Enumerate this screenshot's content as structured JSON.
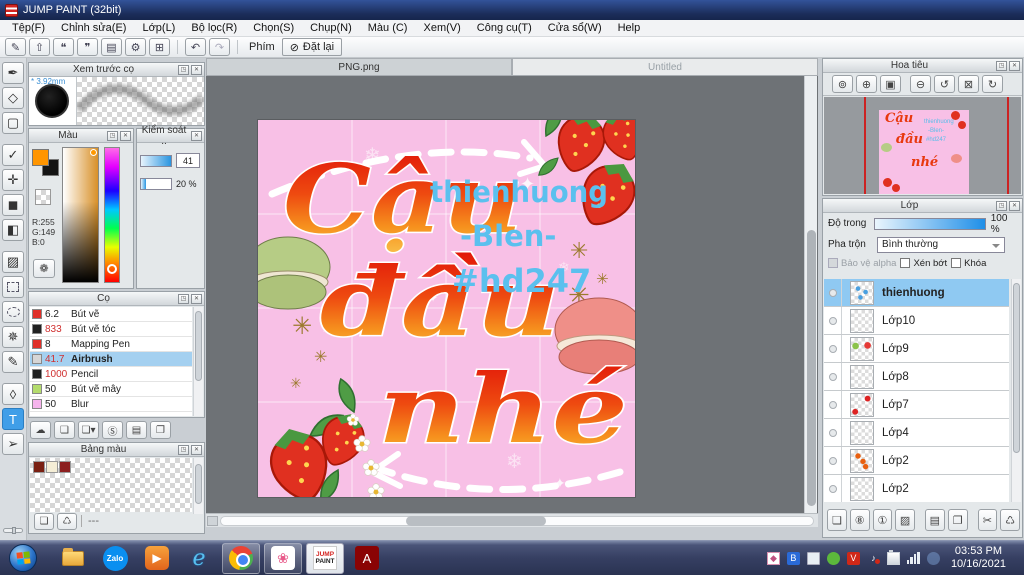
{
  "window": {
    "title": "JUMP PAINT (32bit)"
  },
  "menu": {
    "items": [
      {
        "label": "Tệp(F)"
      },
      {
        "label": "Chỉnh sửa(E)"
      },
      {
        "label": "Lớp(L)"
      },
      {
        "label": "Bộ lọc(R)"
      },
      {
        "label": "Chọn(S)"
      },
      {
        "label": "Chụp(N)"
      },
      {
        "label": "Màu (C)"
      },
      {
        "label": "Xem(V)"
      },
      {
        "label": "Công cụ(T)"
      },
      {
        "label": "Cửa sổ(W)"
      },
      {
        "label": "Help"
      }
    ]
  },
  "toolbar": {
    "main_buttons": [
      {
        "name": "jump-pen-icon",
        "glyph": "✎"
      },
      {
        "name": "upload-icon",
        "glyph": "⇧"
      },
      {
        "name": "comment-icon",
        "glyph": "❝"
      },
      {
        "name": "speech-icon",
        "glyph": "❞"
      },
      {
        "name": "document-icon",
        "glyph": "▤"
      },
      {
        "name": "panel-settings-icon",
        "glyph": "⚙"
      },
      {
        "name": "grid-edit-icon",
        "glyph": "⊞"
      }
    ],
    "undo_glyph": "↶",
    "redo_glyph": "↷",
    "keys_label": "Phím",
    "reset": {
      "glyph": "⊘",
      "label": "Đặt lại"
    }
  },
  "tools": {
    "items": [
      {
        "name": "brush-tool-icon",
        "glyph": "✒"
      },
      {
        "name": "eraser-tool-icon",
        "glyph": "◇"
      },
      {
        "name": "shape-tool-icon",
        "glyph": "▢"
      },
      {
        "name": "dot-pen-tool-icon",
        "glyph": "✓"
      },
      {
        "name": "move-tool-icon",
        "glyph": "✛"
      },
      {
        "name": "fill-shape-tool-icon",
        "glyph": "◼"
      },
      {
        "name": "bucket-tool-icon",
        "glyph": "◧"
      },
      {
        "name": "gradient-tool-icon",
        "glyph": "▨"
      },
      {
        "name": "select-rect-tool-icon",
        "glyph": "",
        "shape": "dashed-rect"
      },
      {
        "name": "lasso-tool-icon",
        "glyph": "",
        "shape": "dashed-ellipse"
      },
      {
        "name": "magic-wand-tool-icon",
        "glyph": "✵"
      },
      {
        "name": "select-pen-tool-icon",
        "glyph": "✎"
      },
      {
        "name": "select-eraser-tool-icon",
        "glyph": "◊"
      },
      {
        "name": "text-tool-icon",
        "glyph": "T",
        "selected": true
      },
      {
        "name": "object-tool-icon",
        "glyph": "➢"
      }
    ]
  },
  "brush_preview": {
    "title": "Xem trước cọ",
    "size_label": "* 3.92mm"
  },
  "color_panel": {
    "title": "Màu",
    "r": "R:255",
    "g": "G:149",
    "b": "B:0",
    "palette_glyph": "❁"
  },
  "control_panel": {
    "title": "Kiểm soát ..",
    "value1": "41",
    "value2": "20 %"
  },
  "brush_panel": {
    "title": "Cọ",
    "items": [
      {
        "size": "6.2",
        "name": "Bút vẽ",
        "swatch": "#e03028",
        "size_red": false
      },
      {
        "size": "833",
        "name": "Bút vẽ tóc",
        "swatch": "#202020",
        "size_red": true
      },
      {
        "size": "8",
        "name": "Mapping Pen",
        "swatch": "#e03028",
        "size_red": false
      },
      {
        "size": "41.7",
        "name": "Airbrush",
        "swatch": "#d6d6d6",
        "size_red": true,
        "selected": true
      },
      {
        "size": "1000",
        "name": "Pencil",
        "swatch": "#202020",
        "size_red": true
      },
      {
        "size": "50",
        "name": "Bút vẽ mây",
        "swatch": "#b4dc6c",
        "size_red": false
      },
      {
        "size": "50",
        "name": "Blur",
        "swatch": "#f6b4ec",
        "size_red": false
      }
    ]
  },
  "brush_buttons": [
    {
      "name": "brush-cloud-upload-icon",
      "glyph": "☁"
    },
    {
      "name": "brush-new-icon",
      "glyph": "❏"
    },
    {
      "name": "brush-save-icon",
      "glyph": "❏▾"
    },
    {
      "name": "brush-sync-icon",
      "glyph": "Ⓢ"
    },
    {
      "name": "brush-folder-icon",
      "glyph": "▤"
    },
    {
      "name": "brush-duplicate-icon",
      "glyph": "❐"
    }
  ],
  "palette_panel": {
    "title": "Bảng màu",
    "swatches": [
      {
        "color": "#7a2012"
      },
      {
        "color": "#f5eed6"
      },
      {
        "color": "#8c1f1f"
      }
    ],
    "footer": "---",
    "buttons": [
      {
        "name": "palette-new-icon",
        "glyph": "❏"
      },
      {
        "name": "palette-delete-icon",
        "glyph": "♺"
      }
    ]
  },
  "canvas": {
    "tabs": [
      {
        "label": "PNG.png",
        "active": true
      },
      {
        "label": "Untitled",
        "active": false
      }
    ]
  },
  "artwork": {
    "line1": "Cậu",
    "line2": "đầu",
    "line3": "nhé",
    "credit1": "thienhuong",
    "credit2": "-Blen-",
    "credit3": "#hd247",
    "bg": "#f8c0e6",
    "credit_color": "#5bc0ee",
    "decor": {
      "snowflake": "❄",
      "sparkle": "✦",
      "gold_star": "✳"
    }
  },
  "navigator": {
    "title": "Hoa tiêu",
    "buttons": [
      {
        "name": "zoom-actual-icon",
        "glyph": "⊚"
      },
      {
        "name": "zoom-in-icon",
        "glyph": "⊕"
      },
      {
        "name": "fit-screen-icon",
        "glyph": "▣"
      },
      {
        "name": "zoom-out-icon",
        "glyph": "⊖"
      },
      {
        "name": "rotate-left-icon",
        "glyph": "↺"
      },
      {
        "name": "rotate-reset-icon",
        "glyph": "⊠"
      },
      {
        "name": "rotate-right-icon",
        "glyph": "↻"
      }
    ]
  },
  "layers_panel": {
    "title": "Lớp",
    "opacity_label": "Độ trong",
    "opacity_value": "100 %",
    "blend_label": "Pha trộn",
    "blend_value": "Bình thường",
    "checkboxes": [
      {
        "label": "Bảo vệ alpha",
        "disabled": true
      },
      {
        "label": "Xén bớt",
        "disabled": false
      },
      {
        "label": "Khóa",
        "disabled": false
      }
    ],
    "items": [
      {
        "name": "thienhuong",
        "selected": true,
        "thumb": "text-blue"
      },
      {
        "name": "Lớp10"
      },
      {
        "name": "Lớp9",
        "thumb": "dots"
      },
      {
        "name": "Lớp8"
      },
      {
        "name": "Lớp7",
        "thumb": "red-marks"
      },
      {
        "name": "Lớp4"
      },
      {
        "name": "Lớp2",
        "thumb": "orange-text"
      },
      {
        "name": "Lớp2"
      }
    ],
    "buttons": [
      {
        "name": "new-layer-icon",
        "glyph": "❏"
      },
      {
        "name": "new-8bit-layer-icon",
        "glyph": "⑧"
      },
      {
        "name": "new-1bit-layer-icon",
        "glyph": "①"
      },
      {
        "name": "tone-layer-icon",
        "glyph": "▨"
      },
      {
        "name": "layer-folder-icon",
        "glyph": "▤"
      },
      {
        "name": "duplicate-layer-icon",
        "glyph": "❐"
      },
      {
        "name": "merge-layer-icon",
        "glyph": "✂"
      },
      {
        "name": "delete-layer-icon",
        "glyph": "♺"
      }
    ]
  },
  "taskbar": {
    "zalo_label": "Zalo",
    "player_glyph": "▶",
    "ie_glyph": "e",
    "pink_glyph": "❀",
    "jump_line1": "JUMP",
    "jump_line2": "PAINT",
    "acrobat_glyph": "A",
    "vlc_glyph": "V",
    "bt_glyph": "B",
    "time": "03:53 PM",
    "date": "10/16/2021"
  }
}
